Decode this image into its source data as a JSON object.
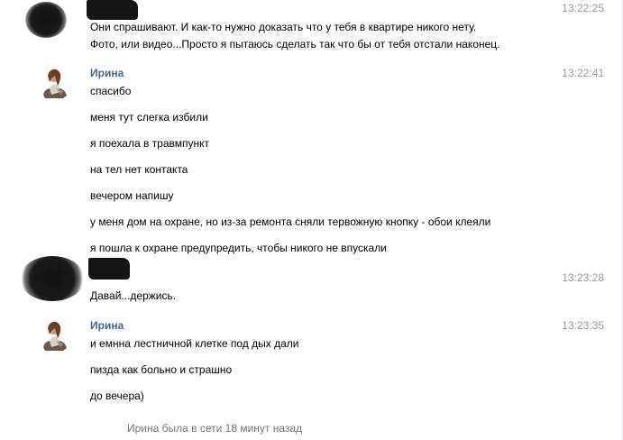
{
  "messages": [
    {
      "author": "",
      "time": "13:22:25",
      "lines": [
        "Они спрашивают. И как-то нужно доказать что у тебя в квартире никого нету.",
        "Фото, или видео...Просто я пытаюсь сделать так что бы от тебя отстали наконец."
      ]
    },
    {
      "author": "Ирина",
      "time": "13:22:41",
      "lines": [
        "спасибо",
        "меня тут слегка избили",
        "я поехала в травмпункт",
        "на тел нет контакта",
        "вечером напишу",
        "у меня дом на охране, но из-за ремонта сняли тервожную кнопку - обои клеяли",
        "я пошла к охране предупредить, чтобы никого не впускали"
      ]
    },
    {
      "author": "",
      "time": "13:23:28",
      "lines": [
        "Давай...держись."
      ]
    },
    {
      "author": "Ирина",
      "time": "13:23:35",
      "lines": [
        "и емнна лестничной клетке под дых дали",
        "пизда как больно и страшно",
        "до вечера)"
      ]
    }
  ],
  "status": {
    "text": "Ирина была в сети 18 минут назад"
  },
  "colors": {
    "author_link": "#45688e",
    "timestamp": "#999999",
    "status_text": "#777777",
    "message_text": "#000000"
  },
  "icons": {
    "irina_avatar": "user-photo-avatar",
    "redacted_avatar": "redacted-avatar"
  }
}
